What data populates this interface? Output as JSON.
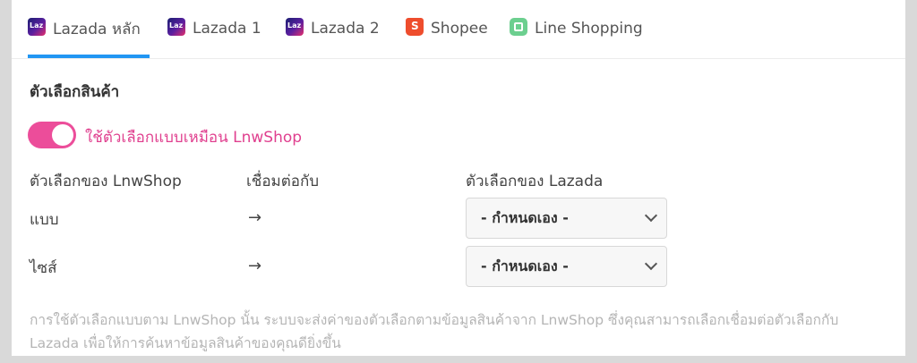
{
  "tabs": [
    {
      "label": "Lazada หลัก",
      "icon": "lazada-icon"
    },
    {
      "label": "Lazada 1",
      "icon": "lazada-icon"
    },
    {
      "label": "Lazada 2",
      "icon": "lazada-icon"
    },
    {
      "label": "Shopee",
      "icon": "shopee-bag-icon"
    },
    {
      "label": "Line Shopping",
      "icon": "line-shopping-bag-icon"
    }
  ],
  "active_tab": "Lazada หลัก",
  "section": {
    "title": "ตัวเลือกสินค้า"
  },
  "toggle": {
    "label": "ใช้ตัวเลือกแบบเหมือน LnwShop",
    "on": true
  },
  "columns": {
    "lnwshop": "ตัวเลือกของ LnwShop",
    "connect": "เชื่อมต่อกับ",
    "lazada": "ตัวเลือกของ Lazada"
  },
  "rows": [
    {
      "label": "แบบ",
      "arrow": "→",
      "selected": "- กำหนดเอง -"
    },
    {
      "label": "ไซส์",
      "arrow": "→",
      "selected": "- กำหนดเอง -"
    }
  ],
  "note": "การใช้ตัวเลือกแบบตาม LnwShop นั้น ระบบจะส่งค่าของตัวเลือกตามข้อมูลสินค้าจาก LnwShop ซึ่งคุณสามารถเลือกเชื่อมต่อตัวเลือกกับ Lazada เพื่อให้การค้นหาข้อมูลสินค้าของคุณดียิ่งขึ้น",
  "colors": {
    "accent_blue": "#2196f3",
    "toggle_pink": "#ec4d9a"
  }
}
